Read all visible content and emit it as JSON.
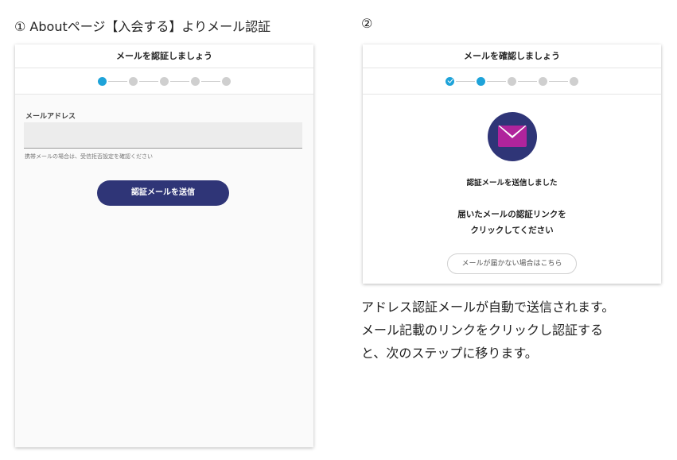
{
  "step1_heading": "① Aboutページ【入会する】よりメール認証",
  "step2_heading": "②",
  "card1": {
    "title": "メールを認証しましょう",
    "field_label": "メールアドレス",
    "email_value": "",
    "helper_text": "携帯メールの場合は、受信拒否設定を確認ください",
    "submit_label": "認証メールを送信"
  },
  "card2": {
    "title": "メールを確認しましょう",
    "icon": "mail-icon",
    "sent_text": "認証メールを送信しました",
    "instruction_line1": "届いたメールの認証リンクを",
    "instruction_line2": "クリックしてください",
    "resend_label": "メールが届かない場合はこちら"
  },
  "stepper": {
    "total_steps": 5,
    "card1_current": 1,
    "card2_current": 2
  },
  "colors": {
    "primary": "#2f3577",
    "step_active": "#1ea3d9",
    "step_inactive": "#cfcfcf",
    "envelope": "#b0249c"
  },
  "description": [
    "アドレス認証メールが自動で送信されます。",
    "メール記載のリンクをクリックし認証する",
    "と、次のステップに移ります。"
  ]
}
